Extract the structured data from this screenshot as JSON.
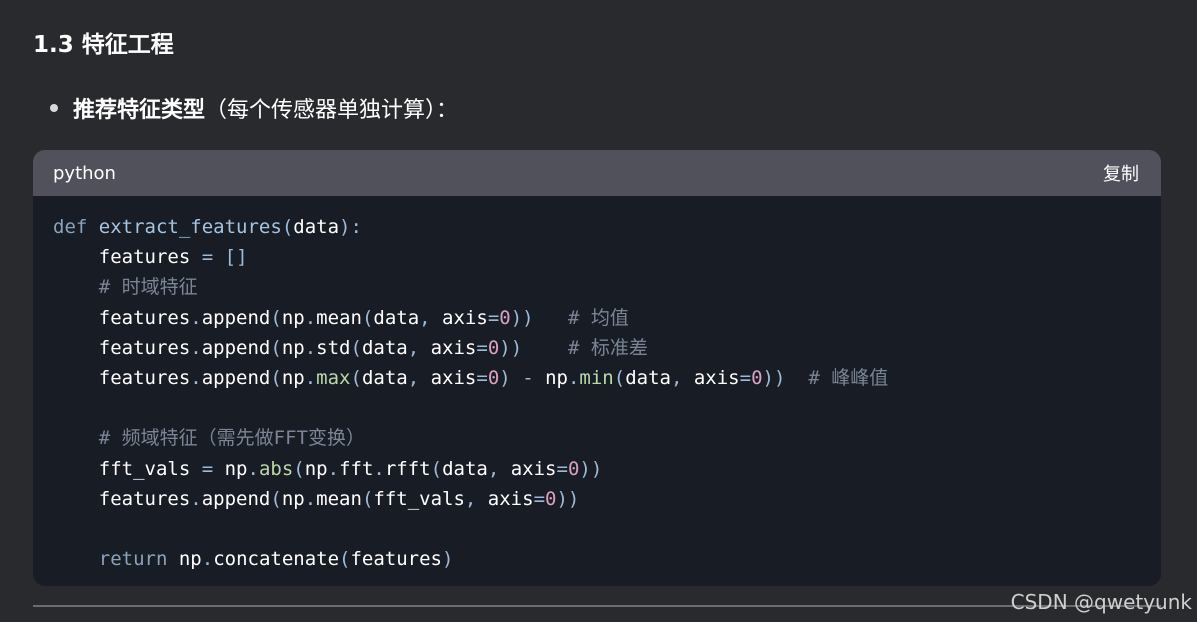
{
  "section": {
    "heading": "1.3 特征工程"
  },
  "bullet": {
    "strong": "推荐特征类型",
    "rest": "（每个传感器单独计算）："
  },
  "code_block": {
    "language": "python",
    "copy_label": "复制",
    "lines": [
      [
        {
          "t": "def",
          "c": "kw"
        },
        {
          "t": " "
        },
        {
          "t": "extract_features",
          "c": "fn"
        },
        {
          "t": "(",
          "c": "p"
        },
        {
          "t": "data"
        },
        {
          "t": "):",
          "c": "p"
        }
      ],
      [
        {
          "t": "    features "
        },
        {
          "t": "=",
          "c": "p"
        },
        {
          "t": " "
        },
        {
          "t": "[]",
          "c": "p"
        }
      ],
      [
        {
          "t": "    # 时域特征",
          "c": "cm"
        }
      ],
      [
        {
          "t": "    features"
        },
        {
          "t": ".",
          "c": "p"
        },
        {
          "t": "append"
        },
        {
          "t": "(",
          "c": "p"
        },
        {
          "t": "np"
        },
        {
          "t": ".",
          "c": "p"
        },
        {
          "t": "mean"
        },
        {
          "t": "(",
          "c": "p"
        },
        {
          "t": "data"
        },
        {
          "t": ",",
          "c": "p"
        },
        {
          "t": " axis"
        },
        {
          "t": "=",
          "c": "p"
        },
        {
          "t": "0",
          "c": "num"
        },
        {
          "t": "))",
          "c": "p"
        },
        {
          "t": "   "
        },
        {
          "t": "# 均值",
          "c": "cm"
        }
      ],
      [
        {
          "t": "    features"
        },
        {
          "t": ".",
          "c": "p"
        },
        {
          "t": "append"
        },
        {
          "t": "(",
          "c": "p"
        },
        {
          "t": "np"
        },
        {
          "t": ".",
          "c": "p"
        },
        {
          "t": "std"
        },
        {
          "t": "(",
          "c": "p"
        },
        {
          "t": "data"
        },
        {
          "t": ",",
          "c": "p"
        },
        {
          "t": " axis"
        },
        {
          "t": "=",
          "c": "p"
        },
        {
          "t": "0",
          "c": "num"
        },
        {
          "t": "))",
          "c": "p"
        },
        {
          "t": "    "
        },
        {
          "t": "# 标准差",
          "c": "cm"
        }
      ],
      [
        {
          "t": "    features"
        },
        {
          "t": ".",
          "c": "p"
        },
        {
          "t": "append"
        },
        {
          "t": "(",
          "c": "p"
        },
        {
          "t": "np"
        },
        {
          "t": ".",
          "c": "p"
        },
        {
          "t": "max",
          "c": "bi"
        },
        {
          "t": "(",
          "c": "p"
        },
        {
          "t": "data"
        },
        {
          "t": ",",
          "c": "p"
        },
        {
          "t": " axis"
        },
        {
          "t": "=",
          "c": "p"
        },
        {
          "t": "0",
          "c": "num"
        },
        {
          "t": ")",
          "c": "p"
        },
        {
          "t": " "
        },
        {
          "t": "-",
          "c": "p"
        },
        {
          "t": " np"
        },
        {
          "t": ".",
          "c": "p"
        },
        {
          "t": "min",
          "c": "bi"
        },
        {
          "t": "(",
          "c": "p"
        },
        {
          "t": "data"
        },
        {
          "t": ",",
          "c": "p"
        },
        {
          "t": " axis"
        },
        {
          "t": "=",
          "c": "p"
        },
        {
          "t": "0",
          "c": "num"
        },
        {
          "t": "))",
          "c": "p"
        },
        {
          "t": "  "
        },
        {
          "t": "# 峰峰值",
          "c": "cm"
        }
      ],
      [
        {
          "t": ""
        }
      ],
      [
        {
          "t": "    # 频域特征（需先做FFT变换）",
          "c": "cm"
        }
      ],
      [
        {
          "t": "    fft_vals "
        },
        {
          "t": "=",
          "c": "p"
        },
        {
          "t": " np"
        },
        {
          "t": ".",
          "c": "p"
        },
        {
          "t": "abs",
          "c": "bi"
        },
        {
          "t": "(",
          "c": "p"
        },
        {
          "t": "np"
        },
        {
          "t": ".",
          "c": "p"
        },
        {
          "t": "fft"
        },
        {
          "t": ".",
          "c": "p"
        },
        {
          "t": "rfft"
        },
        {
          "t": "(",
          "c": "p"
        },
        {
          "t": "data"
        },
        {
          "t": ",",
          "c": "p"
        },
        {
          "t": " axis"
        },
        {
          "t": "=",
          "c": "p"
        },
        {
          "t": "0",
          "c": "num"
        },
        {
          "t": "))",
          "c": "p"
        }
      ],
      [
        {
          "t": "    features"
        },
        {
          "t": ".",
          "c": "p"
        },
        {
          "t": "append"
        },
        {
          "t": "(",
          "c": "p"
        },
        {
          "t": "np"
        },
        {
          "t": ".",
          "c": "p"
        },
        {
          "t": "mean"
        },
        {
          "t": "(",
          "c": "p"
        },
        {
          "t": "fft_vals"
        },
        {
          "t": ",",
          "c": "p"
        },
        {
          "t": " axis"
        },
        {
          "t": "=",
          "c": "p"
        },
        {
          "t": "0",
          "c": "num"
        },
        {
          "t": "))",
          "c": "p"
        }
      ],
      [
        {
          "t": ""
        }
      ],
      [
        {
          "t": "    "
        },
        {
          "t": "return",
          "c": "kw"
        },
        {
          "t": " np"
        },
        {
          "t": ".",
          "c": "p"
        },
        {
          "t": "concatenate"
        },
        {
          "t": "(",
          "c": "p"
        },
        {
          "t": "features"
        },
        {
          "t": ")",
          "c": "p"
        }
      ]
    ]
  },
  "watermark": "CSDN @qwetyunk",
  "colors": {
    "page_bg": "#292a2d",
    "code_bg": "#181c25",
    "header_bg": "#50515a",
    "keyword": "#8aa2bb",
    "function_name": "#a5c4e2",
    "punctuation": "#9dbad8",
    "number": "#d9a0c0",
    "builtin": "#bcd8a7",
    "comment": "#7b8595"
  }
}
